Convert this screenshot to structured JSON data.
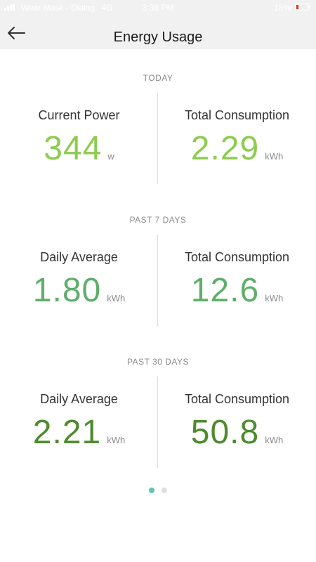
{
  "status_bar": {
    "carrier": "Wear Mask - Dialog",
    "network": "4G",
    "time": "3:36 PM",
    "battery": "18%"
  },
  "header": {
    "title": "Energy Usage",
    "back_icon": "arrow-left-icon"
  },
  "colors": {
    "today_value": "#8dcc4f",
    "week_value": "#5fae6a",
    "month_value": "#4f8a2f",
    "active_dot": "#5bc7b2"
  },
  "sections": [
    {
      "label": "TODAY",
      "left": {
        "label": "Current Power",
        "value": "344",
        "unit": "w"
      },
      "right": {
        "label": "Total Consumption",
        "value": "2.29",
        "unit": "kWh"
      }
    },
    {
      "label": "PAST 7 DAYS",
      "left": {
        "label": "Daily Average",
        "value": "1.80",
        "unit": "kWh"
      },
      "right": {
        "label": "Total Consumption",
        "value": "12.6",
        "unit": "kWh"
      }
    },
    {
      "label": "PAST 30 DAYS",
      "left": {
        "label": "Daily Average",
        "value": "2.21",
        "unit": "kWh"
      },
      "right": {
        "label": "Total Consumption",
        "value": "50.8",
        "unit": "kWh"
      }
    }
  ],
  "pager": {
    "pages": 2,
    "active": 1
  }
}
